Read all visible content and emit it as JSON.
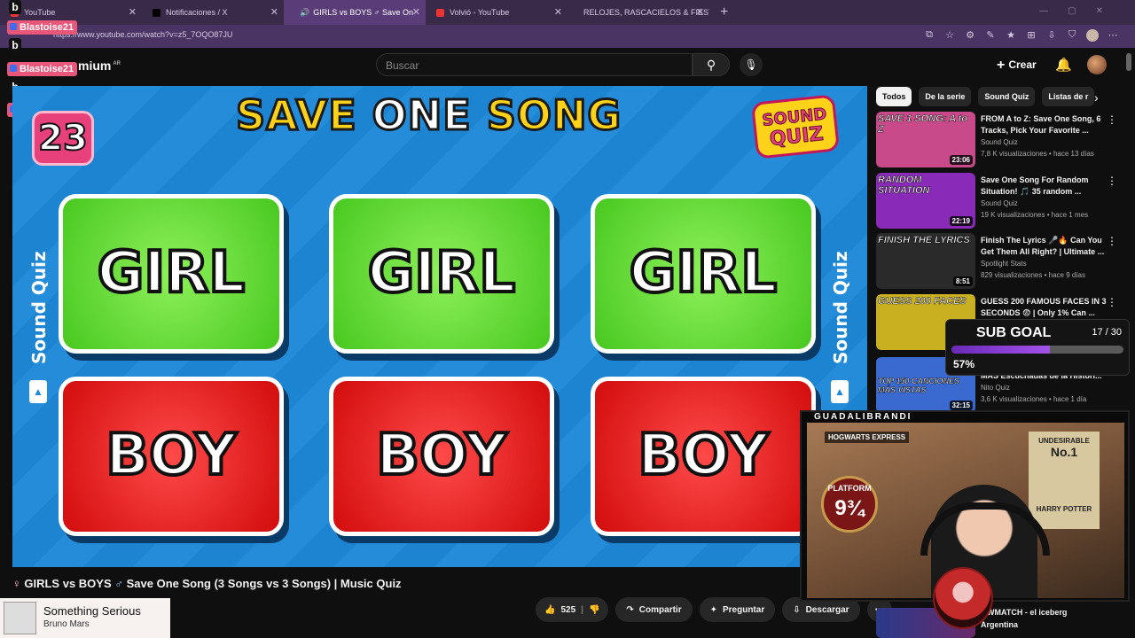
{
  "browser": {
    "tabs": [
      {
        "label": "YouTube",
        "active": false
      },
      {
        "label": "Notificaciones / X",
        "active": false
      },
      {
        "label": "GIRLS vs BOYS ♂ Save On",
        "active": true
      },
      {
        "label": "Volvió - YouTube",
        "active": false
      },
      {
        "label": "RELOJES, RASCACIELOS & FIESTAS",
        "active": false
      }
    ],
    "url": "https://www.youtube.com/watch?v=z5_7OQO87JU",
    "accent": "#5a3d78"
  },
  "overlay": {
    "chat_user": "Blastoise21",
    "chat_letter": "b"
  },
  "youtube": {
    "logo_text": "mium",
    "region": "AR",
    "search_placeholder": "Buscar",
    "create_label": "Crear"
  },
  "video": {
    "headline_left": "SAVE",
    "headline_mid": "ONE",
    "headline_right": "SONG",
    "counter": "23",
    "logo_line1": "SOUND",
    "logo_line2": "QUIZ",
    "side_label": "Sound Quiz",
    "card_top": "GIRL",
    "card_bottom": "BOY",
    "title_part1": "GIRLS vs BOYS",
    "title_part2": "Save One Song (3 Songs vs 3 Songs) | Music Quiz"
  },
  "now_playing": {
    "song": "Something Serious",
    "artist": "Bruno Mars"
  },
  "actions": {
    "likes": "525",
    "share": "Compartir",
    "ask": "Preguntar",
    "download": "Descargar"
  },
  "chips": [
    "Todos",
    "De la serie",
    "Sound Quiz",
    "Listas de r"
  ],
  "recommendations": [
    {
      "thumb_text": "SAVE 1 SONG: A to Z",
      "duration": "23:06",
      "title": "FROM A to Z: Save One Song, 6 Tracks, Pick Your Favorite ...",
      "channel": "Sound Quiz",
      "meta": "7,8 K visualizaciones • hace 13 días",
      "color": "#c94a8a"
    },
    {
      "thumb_text": "RANDOM SITUATION",
      "duration": "22:19",
      "title": "Save One Song For Random Situation! 🎵 35 random ...",
      "channel": "Sound Quiz",
      "meta": "19 K visualizaciones • hace 1 mes",
      "color": "#8a2ab8"
    },
    {
      "thumb_text": "FINISH THE LYRICS",
      "duration": "8:51",
      "title": "Finish The Lyrics 🎤🔥 Can You Get Them All Right? | Ultimate ...",
      "channel": "Spotlight Stats",
      "meta": "829 visualizaciones • hace 9 días",
      "color": "#2a2a2a"
    },
    {
      "thumb_text": "GUESS 200 FACES",
      "duration": "",
      "title": "GUESS 200 FAMOUS FACES IN 3 SECONDS 😨 | Only 1% Can ...",
      "channel": "",
      "meta": "",
      "color": "#c8b020"
    },
    {
      "thumb_text": "TOP 150 CANCIONES MÁS VISTAS",
      "duration": "32:15",
      "title": "MÁS Escuchadas de la Histori...",
      "channel": "Nito Quiz",
      "meta": "3,6 K visualizaciones • hace 1 día",
      "color": "#3a6ad0"
    }
  ],
  "rec_last": {
    "title": "OWMATCH - el iceberg",
    "channel": "Argentina"
  },
  "sub_goal": {
    "title": "SUB GOAL",
    "count": "17 / 30",
    "percent_label": "57%",
    "progress": 0.57
  },
  "webcam": {
    "name": "GUADALIBRANDI",
    "platform_label": "PLATFORM",
    "platform_num": "9¾",
    "hogwarts": "HOGWARTS EXPRESS",
    "poster_top": "UNDESIRABLE",
    "poster_num": "No.1",
    "poster_name": "HARRY POTTER"
  }
}
